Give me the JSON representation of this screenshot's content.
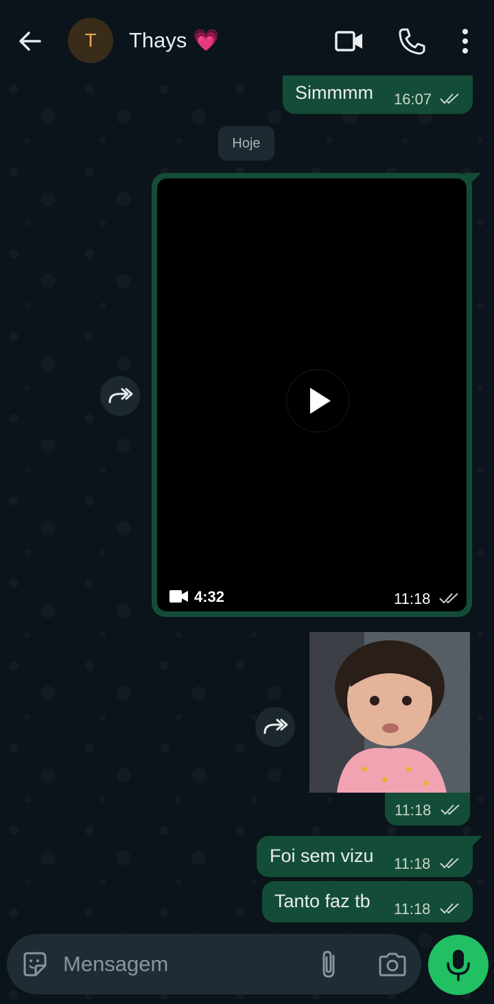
{
  "header": {
    "avatar_letter": "T",
    "contact_name": "Thays 💗",
    "icons": [
      "back-arrow-icon",
      "video-call-icon",
      "phone-icon",
      "more-options-icon"
    ]
  },
  "messages": {
    "m1": {
      "text": "Simmmm",
      "time": "16:07"
    },
    "date_chip": "Hoje",
    "video": {
      "duration": "4:32",
      "time": "11:18"
    },
    "photo": {
      "time": "11:18"
    },
    "m2": {
      "text": "Foi sem vizu",
      "time": "11:18"
    },
    "m3": {
      "text": "Tanto faz tb",
      "time": "11:18"
    }
  },
  "composer": {
    "placeholder": "Mensagem",
    "icons": [
      "sticker-icon",
      "attach-icon",
      "camera-icon",
      "mic-icon"
    ]
  },
  "colors": {
    "background": "#0b141a",
    "outgoing_bubble": "#144d37",
    "mic_button": "#21c063",
    "avatar_bg": "#3a2c1b",
    "avatar_letter": "#e0a84f"
  }
}
